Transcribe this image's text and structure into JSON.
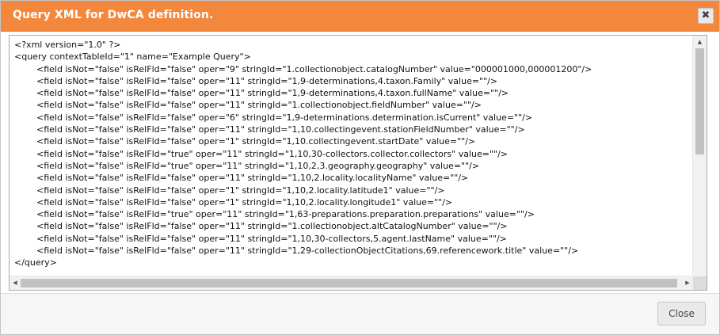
{
  "dialog": {
    "title": "Query XML for DwCA definition.",
    "close_icon": "close-icon",
    "close_glyph": "✖"
  },
  "xml_lines": [
    "<?xml version=\"1.0\" ?>",
    "<query contextTableId=\"1\" name=\"Example Query\">",
    "        <field isNot=\"false\" isRelFld=\"false\" oper=\"9\" stringId=\"1.collectionobject.catalogNumber\" value=\"000001000,000001200\"/>",
    "        <field isNot=\"false\" isRelFld=\"false\" oper=\"11\" stringId=\"1,9-determinations,4.taxon.Family\" value=\"\"/>",
    "        <field isNot=\"false\" isRelFld=\"false\" oper=\"11\" stringId=\"1,9-determinations,4.taxon.fullName\" value=\"\"/>",
    "        <field isNot=\"false\" isRelFld=\"false\" oper=\"11\" stringId=\"1.collectionobject.fieldNumber\" value=\"\"/>",
    "        <field isNot=\"false\" isRelFld=\"false\" oper=\"6\" stringId=\"1,9-determinations.determination.isCurrent\" value=\"\"/>",
    "        <field isNot=\"false\" isRelFld=\"false\" oper=\"11\" stringId=\"1,10.collectingevent.stationFieldNumber\" value=\"\"/>",
    "        <field isNot=\"false\" isRelFld=\"false\" oper=\"1\" stringId=\"1,10.collectingevent.startDate\" value=\"\"/>",
    "        <field isNot=\"false\" isRelFld=\"true\" oper=\"11\" stringId=\"1,10,30-collectors.collector.collectors\" value=\"\"/>",
    "        <field isNot=\"false\" isRelFld=\"true\" oper=\"11\" stringId=\"1,10,2,3.geography.geography\" value=\"\"/>",
    "        <field isNot=\"false\" isRelFld=\"false\" oper=\"11\" stringId=\"1,10,2.locality.localityName\" value=\"\"/>",
    "        <field isNot=\"false\" isRelFld=\"false\" oper=\"1\" stringId=\"1,10,2.locality.latitude1\" value=\"\"/>",
    "        <field isNot=\"false\" isRelFld=\"false\" oper=\"1\" stringId=\"1,10,2.locality.longitude1\" value=\"\"/>",
    "        <field isNot=\"false\" isRelFld=\"true\" oper=\"11\" stringId=\"1,63-preparations.preparation.preparations\" value=\"\"/>",
    "        <field isNot=\"false\" isRelFld=\"false\" oper=\"11\" stringId=\"1.collectionobject.altCatalogNumber\" value=\"\"/>",
    "        <field isNot=\"false\" isRelFld=\"false\" oper=\"11\" stringId=\"1,10,30-collectors,5.agent.lastName\" value=\"\"/>",
    "        <field isNot=\"false\" isRelFld=\"false\" oper=\"11\" stringId=\"1,29-collectionObjectCitations,69.referencework.title\" value=\"\"/>",
    "</query>"
  ],
  "scrollbars": {
    "up_arrow": "▲",
    "down_arrow": "▼",
    "left_arrow": "◀",
    "right_arrow": "▶"
  },
  "footer": {
    "close_label": "Close"
  }
}
